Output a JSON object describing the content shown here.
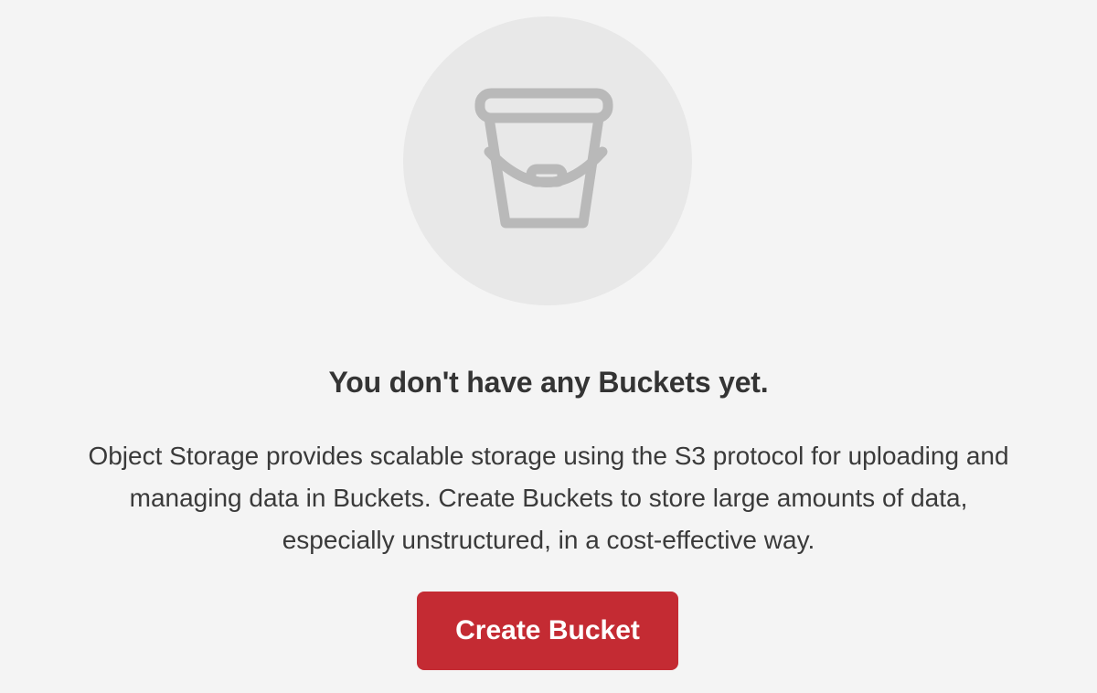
{
  "empty_state": {
    "icon": "bucket-icon",
    "heading": "You don't have any Buckets yet.",
    "description_lines": [
      "Object Storage provides scalable storage using the S3 protocol for uploading and",
      "managing data in Buckets. Create Buckets to store large amounts of data,",
      "especially unstructured, in a cost-effective way."
    ],
    "button_label": "Create Bucket"
  },
  "colors": {
    "background": "#f4f4f4",
    "illustration_circle": "#e8e8e8",
    "icon_stroke": "#b9b9b9",
    "heading_text": "#343434",
    "body_text": "#3a3a3a",
    "primary_button": "#c42b33",
    "primary_button_text": "#ffffff"
  }
}
